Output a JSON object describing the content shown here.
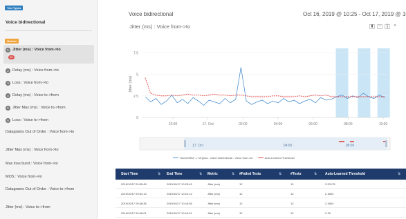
{
  "sidebar": {
    "test_types_badge": "Test Types",
    "test_type": "Voice bidirectional",
    "metrics_badge": "Metrics",
    "metrics": [
      {
        "num": "1",
        "label": "Jitter (ms) : Voice from->to",
        "badge": "83"
      },
      {
        "num": "2",
        "label": "Delay (ms) : Voice from->to"
      },
      {
        "num": "3",
        "label": "Loss : Voice from->to"
      },
      {
        "num": "4",
        "label": "Delay (ms) : Voice to->from"
      },
      {
        "num": "5",
        "label": "Jitter Max (ms) : Voice to->from"
      },
      {
        "num": "6",
        "label": "Loss : Voice to->from"
      },
      {
        "label": "Datagrams Out of Order : Voice from->to"
      },
      {
        "label": "Jitter Max (ms) : Voice from->to"
      },
      {
        "label": "Max loss burst : Voice from->to"
      },
      {
        "label": "MOS : Voice from->to"
      },
      {
        "label": "Datagrams Out of Order : Voice to->from"
      },
      {
        "label": "Jitter (ms) : Voice to->from"
      }
    ]
  },
  "header": {
    "title": "Voice bidirectional",
    "date_range": "Oct 16, 2019 @ 10:25 - Oct 17, 2019 @ 10:2"
  },
  "chart_title": "Jitter (ms) : Voice from->to",
  "view_buttons": [
    "bar-chart-icon",
    "line-chart-icon",
    "column-chart-icon",
    "menu-icon"
  ],
  "chart_data": {
    "type": "line",
    "ylabel": "Jitter (ms)",
    "yticks": [
      "7.5",
      "5",
      "2.5",
      "0"
    ],
    "xticks": [
      "22:00",
      "17. Oct",
      "02:00",
      "04:00",
      "06:00",
      "08:00",
      "10:00"
    ],
    "ylim": [
      0,
      8
    ],
    "series": [
      {
        "name": "HomeOffice -> Virginia - Voice bidirectional - Voice from->to",
        "color": "#4a8fd0",
        "values": [
          2.4,
          1.8,
          2.2,
          1.5,
          1.9,
          2.6,
          1.7,
          2.1,
          1.6,
          2.3,
          1.9,
          1.4,
          2.0,
          1.8,
          1.6,
          2.2,
          1.7,
          2.1,
          5.8,
          1.9,
          1.5,
          1.8,
          2.0,
          1.6,
          1.9,
          1.7,
          2.2,
          1.8,
          2.0,
          1.6,
          1.9,
          2.1,
          1.7,
          2.3,
          2.0,
          2.1,
          2.4,
          2.6,
          2.2,
          2.5,
          2.3,
          2.8,
          2.4,
          2.2,
          2.6,
          2.3
        ]
      },
      {
        "name": "Auto-Learned Threshold",
        "color": "#e74c4c",
        "values": [
          4.6,
          2.8,
          2.6,
          2.5,
          2.5,
          2.6,
          2.5,
          2.6,
          2.7,
          2.6,
          2.6,
          2.5,
          2.6,
          2.7,
          2.6,
          2.6,
          2.5,
          2.6,
          2.6,
          2.5,
          2.4,
          2.4,
          2.4,
          2.4,
          2.5,
          2.5,
          2.4,
          2.4,
          2.4,
          2.5,
          2.4,
          2.5,
          2.6,
          2.5,
          2.6,
          2.4,
          2.4,
          2.4,
          2.4,
          2.4,
          2.4,
          2.4,
          2.4,
          2.4,
          2.4,
          2.4
        ]
      }
    ],
    "anomaly_bands": [
      0.815,
      0.905,
      0.985
    ],
    "navigator_labels": [
      "17. Oct",
      "04:00",
      "08:00"
    ]
  },
  "table": {
    "headers": [
      "Start Time",
      "End Time",
      "Metric",
      "#Failed Tests",
      "#Tests",
      "Auto-Learned Threshold"
    ],
    "rows": [
      [
        "2019/10/17 09:55:45",
        "2019/10/17 10:23:45",
        "Jitter (ms)",
        "12",
        "12",
        "2.20175"
      ],
      [
        "2019/10/17 09:51:14",
        "2019/10/17 10:21:14",
        "Jitter (ms)",
        "12",
        "12",
        "2.1804"
      ],
      [
        "2019/10/17 09:48:36",
        "2019/10/17 10:18:36",
        "Jitter (ms)",
        "12",
        "12",
        "2.1804"
      ],
      [
        "2019/10/17 09:46:01",
        "2019/10/17 10:16:01",
        "Jitter (ms)",
        "12",
        "12",
        "2.15"
      ]
    ]
  }
}
